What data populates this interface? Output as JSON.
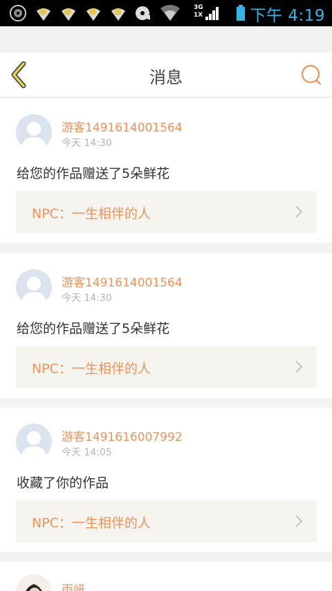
{
  "status_bar": {
    "time": "下午 4:19",
    "network_top": "3G",
    "network_bottom": "1X",
    "icons": [
      "disc-icon",
      "notification-icon",
      "notification-icon",
      "notification-icon",
      "notification-icon",
      "sd-card-icon",
      "wifi-icon",
      "signal-icon",
      "battery-icon"
    ]
  },
  "header": {
    "title": "消息",
    "back_icon": "back-chevron-icon",
    "search_icon": "search-icon"
  },
  "messages": [
    {
      "username": "游客1491614001564",
      "time": "今天 14:30",
      "text": "给您的作品赠送了5朵鲜花",
      "work": "NPC：一生相伴的人"
    },
    {
      "username": "游客1491614001564",
      "time": "今天 14:30",
      "text": "给您的作品赠送了5朵鲜花",
      "work": "NPC：一生相伴的人"
    },
    {
      "username": "游客1491616007992",
      "time": "今天 14:05",
      "text": "收藏了你的作品",
      "work": "NPC：一生相伴的人"
    },
    {
      "username": "雨岍"
    }
  ],
  "colors": {
    "accent": "#f0935a",
    "back_icon": "#e8d35a",
    "status_text": "#33b5e5",
    "card_link_bg": "#f5f4ef"
  }
}
